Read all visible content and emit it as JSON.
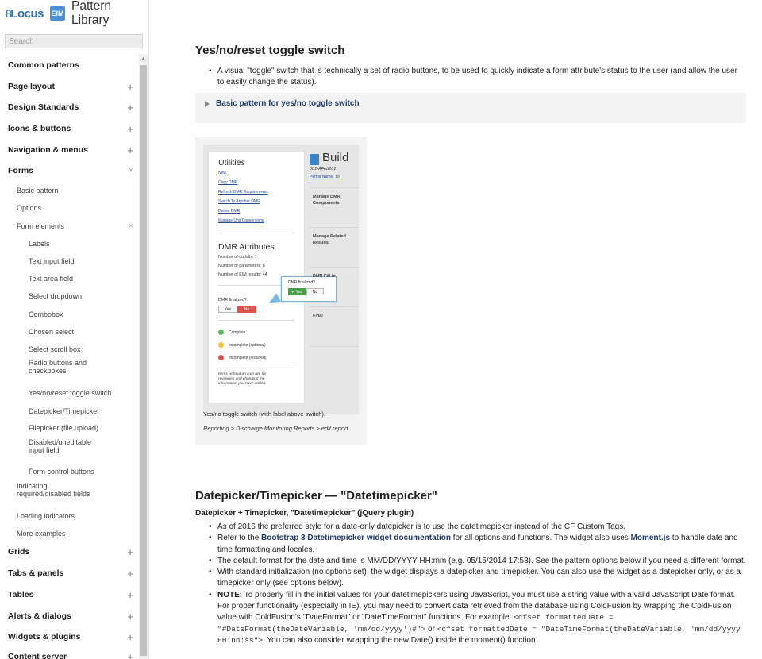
{
  "brand": {
    "logo_text": "Locus",
    "eim": "EIM",
    "title": "Pattern Library"
  },
  "search": {
    "placeholder": "Search"
  },
  "nav": [
    {
      "level": 1,
      "label": "Common patterns",
      "toggle": ""
    },
    {
      "level": 1,
      "label": "Page layout",
      "toggle": "+"
    },
    {
      "level": 1,
      "label": "Design Standards",
      "toggle": "+"
    },
    {
      "level": 1,
      "label": "Icons & buttons",
      "toggle": "+"
    },
    {
      "level": 1,
      "label": "Navigation & menus",
      "toggle": "+"
    },
    {
      "level": 1,
      "label": "Forms",
      "toggle": "×"
    },
    {
      "level": 2,
      "label": "Basic pattern",
      "toggle": ""
    },
    {
      "level": 2,
      "label": "Options",
      "toggle": ""
    },
    {
      "level": 2,
      "label": "Form elements",
      "toggle": "×"
    },
    {
      "level": 3,
      "label": "Labels",
      "toggle": ""
    },
    {
      "level": 3,
      "label": "Text input field",
      "toggle": ""
    },
    {
      "level": 3,
      "label": "Text area field",
      "toggle": ""
    },
    {
      "level": 3,
      "label": "Select dropdown",
      "toggle": ""
    },
    {
      "level": 3,
      "label": "Combobox",
      "toggle": ""
    },
    {
      "level": 3,
      "label": "Chosen select",
      "toggle": ""
    },
    {
      "level": 3,
      "label": "Select scroll box",
      "toggle": ""
    },
    {
      "level": 3,
      "label": "Radio buttons and checkboxes",
      "toggle": ""
    },
    {
      "level": 3,
      "label": "Yes/no/reset toggle switch",
      "toggle": ""
    },
    {
      "level": 3,
      "label": "Datepicker/Timepicker",
      "toggle": ""
    },
    {
      "level": 3,
      "label": "Filepicker (file upload)",
      "toggle": ""
    },
    {
      "level": 3,
      "label": "Disabled/uneditable input field",
      "toggle": ""
    },
    {
      "level": 3,
      "label": "Form control buttons",
      "toggle": ""
    },
    {
      "level": 2,
      "label": "Indicating required/disabled fields",
      "toggle": ""
    },
    {
      "level": 2,
      "label": "Loading indicators",
      "toggle": ""
    },
    {
      "level": 2,
      "label": "More examples",
      "toggle": ""
    },
    {
      "level": 1,
      "label": "Grids",
      "toggle": "+"
    },
    {
      "level": 1,
      "label": "Tabs & panels",
      "toggle": "+"
    },
    {
      "level": 1,
      "label": "Tables",
      "toggle": "+"
    },
    {
      "level": 1,
      "label": "Alerts & dialogs",
      "toggle": "+"
    },
    {
      "level": 1,
      "label": "Widgets & plugins",
      "toggle": "+"
    },
    {
      "level": 1,
      "label": "Content server",
      "toggle": "+"
    }
  ],
  "toggle_section": {
    "title": "Yes/no/reset toggle switch",
    "bullet": "A visual \"toggle\" switch that is technically a set of radio buttons, to be used to quickly indicate a form attribute's status to the user (and allow the user to easily change the status).",
    "accordion": "Basic pattern for yes/no toggle switch",
    "figure": {
      "utilities_title": "Utilities",
      "links": [
        "New",
        "Copy DMR",
        "Refresh DMR Requirements",
        "Switch To Another DMR",
        "Delete DMR",
        "Manage Unit Conversions"
      ],
      "attributes_title": "DMR Attributes",
      "attrs": [
        "Number of outfalls: 1",
        "Number of parameters: 6",
        "Number of EIM results: 44"
      ],
      "finalized_label": "DMR finalized?",
      "yes": "Yes",
      "no": "No",
      "popover_title": "DMR finalized?",
      "popover_yes": "✔ Yes",
      "popover_no": "No",
      "statuses": [
        {
          "label": "Complete",
          "color": "#5cb85c"
        },
        {
          "label": "Incomplete (optional)",
          "color": "#f0c43c"
        },
        {
          "label": "Incomplete (required)",
          "color": "#d9534f"
        }
      ],
      "note": "Items without an icon are for reviewing and changing the information you have added.",
      "build_title": "Build",
      "build_sub": "001-AFeb201",
      "permit": "Permit Name: 'Di",
      "phases": [
        "Manage DMR Components",
        "Manage Related Results",
        "DMR Fill-in",
        "Final"
      ],
      "caption": "Yes/no toggle switch (with label above switch).",
      "source": "Reporting > Discharge Monitoring Reports > edit report"
    }
  },
  "datetime_section": {
    "title": "Datepicker/Timepicker — \"Datetimepicker\"",
    "subtitle": "Datepicker + Timepicker, \"Datetimepicker\" (jQuery plugin)",
    "b1": "As of 2016 the preferred style for a date-only datepicker is to use the datetimepicker instead of the CF Custom Tags.",
    "b2_pre": "Refer to the ",
    "b2_link": "Bootstrap 3 Datetimepicker widget documentation",
    "b2_mid": " for all options and functions. The widget also uses ",
    "b2_link2": "Moment.js",
    "b2_post": " to handle date and time formatting and locales.",
    "b3": "The default format for the date and time is MM/DD/YYYY HH:mm (e.g. 05/15/2014 17:58). See the pattern options below if you need a different format.",
    "b4": "With standard initialization (no options set), the widget displays a datepicker and timepicker. You can also use the widget as a datepicker only, or as a timepicker only (see options below).",
    "b5_note": "NOTE:",
    "b5_text": " To properly fill in the initial values for your datetimepickers using JavaScript, you must use a string value with a valid JavaScript Date format. For proper functionality (especially in IE), you may need to convert data retrieved from the database using ColdFusion by wrapping the ColdFusion value with ColdFusion's \"DateFormat\" or \"DateTimeFormat\" functions. For example: ",
    "b5_code1": "<cfset formattedDate = \"#DateFormat(theDateVariable, 'mm/dd/yyyy')#\">",
    "b5_or": " or ",
    "b5_code2": "<cfset formattedDate = \"DateTimeFormat(theDateVariable, 'mm/dd/yyyy HH:nn:ss\">",
    "b5_end": ". You can also consider wrapping the new Date() inside the moment() function"
  }
}
